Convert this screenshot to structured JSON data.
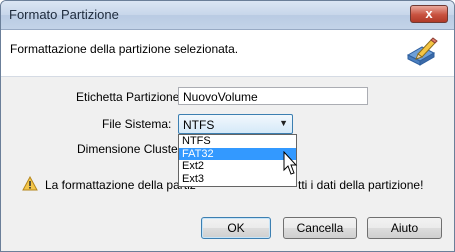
{
  "window": {
    "title": "Formato Partizione",
    "close_label": "x"
  },
  "header": {
    "text": "Formattazione della partizione selezionata.",
    "icon": "pencil-eraser-icon"
  },
  "form": {
    "label_field": {
      "label": "Etichetta Partizione:",
      "value": "NuovoVolume"
    },
    "filesystem": {
      "label": "File Sistema:",
      "selected": "NTFS",
      "options": [
        "NTFS",
        "FAT32",
        "Ext2",
        "Ext3"
      ],
      "highlighted": "FAT32"
    },
    "cluster": {
      "label": "Dimensione Cluster:"
    }
  },
  "warning": {
    "text_before": "La formattazione della partiz",
    "text_after": "tti i dati della partizione!",
    "icon": "warning-icon"
  },
  "buttons": {
    "ok": "OK",
    "cancel": "Cancella",
    "help": "Aiuto"
  },
  "colors": {
    "highlight": "#3399ff",
    "titlebar": "#c7d6ea"
  }
}
